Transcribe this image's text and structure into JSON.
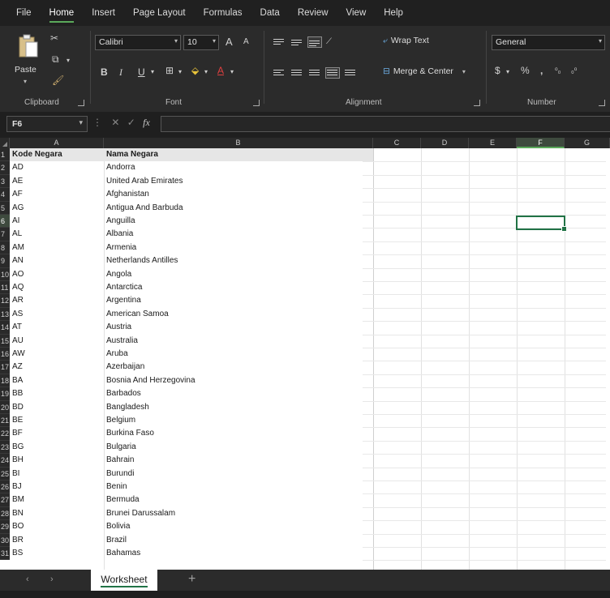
{
  "menu": {
    "items": [
      "File",
      "Home",
      "Insert",
      "Page Layout",
      "Formulas",
      "Data",
      "Review",
      "View",
      "Help"
    ],
    "active": "Home"
  },
  "ribbon": {
    "clipboard": {
      "paste_label": "Paste",
      "group_label": "Clipboard"
    },
    "font": {
      "font_name": "Calibri",
      "font_size": "10",
      "group_label": "Font"
    },
    "alignment": {
      "wrap_text": "Wrap Text",
      "merge_center": "Merge & Center",
      "group_label": "Alignment"
    },
    "number": {
      "format": "General",
      "group_label": "Number"
    }
  },
  "formula_bar": {
    "name_box": "F6",
    "content": ""
  },
  "grid": {
    "columns": [
      "A",
      "B",
      "C",
      "D",
      "E",
      "F",
      "G"
    ],
    "selected_column": "F",
    "selected_row": 6,
    "rows": [
      [
        "1",
        "Kode Negara",
        "Nama Negara"
      ],
      [
        "2",
        "AD",
        "Andorra"
      ],
      [
        "3",
        "AE",
        "United Arab Emirates"
      ],
      [
        "4",
        "AF",
        "Afghanistan"
      ],
      [
        "5",
        "AG",
        "Antigua And Barbuda"
      ],
      [
        "6",
        "AI",
        "Anguilla"
      ],
      [
        "7",
        "AL",
        "Albania"
      ],
      [
        "8",
        "AM",
        "Armenia"
      ],
      [
        "9",
        "AN",
        "Netherlands Antilles"
      ],
      [
        "10",
        "AO",
        "Angola"
      ],
      [
        "11",
        "AQ",
        "Antarctica"
      ],
      [
        "12",
        "AR",
        "Argentina"
      ],
      [
        "13",
        "AS",
        "American Samoa"
      ],
      [
        "14",
        "AT",
        "Austria"
      ],
      [
        "15",
        "AU",
        "Australia"
      ],
      [
        "16",
        "AW",
        "Aruba"
      ],
      [
        "17",
        "AZ",
        "Azerbaijan"
      ],
      [
        "18",
        "BA",
        "Bosnia And Herzegovina"
      ],
      [
        "19",
        "BB",
        "Barbados"
      ],
      [
        "20",
        "BD",
        "Bangladesh"
      ],
      [
        "21",
        "BE",
        "Belgium"
      ],
      [
        "22",
        "BF",
        "Burkina Faso"
      ],
      [
        "23",
        "BG",
        "Bulgaria"
      ],
      [
        "24",
        "BH",
        "Bahrain"
      ],
      [
        "25",
        "BI",
        "Burundi"
      ],
      [
        "26",
        "BJ",
        "Benin"
      ],
      [
        "27",
        "BM",
        "Bermuda"
      ],
      [
        "28",
        "BN",
        "Brunei Darussalam"
      ],
      [
        "29",
        "BO",
        "Bolivia"
      ],
      [
        "30",
        "BR",
        "Brazil"
      ],
      [
        "31",
        "BS",
        "Bahamas"
      ]
    ]
  },
  "sheets": {
    "active": "Worksheet",
    "add_label": "+"
  },
  "colors": {
    "accent": "#217346",
    "tab_underline": "#5ba95b"
  }
}
